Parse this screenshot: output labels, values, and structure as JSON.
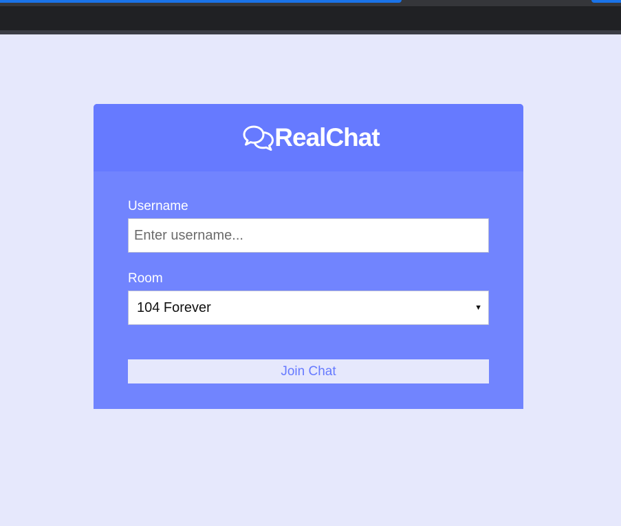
{
  "app": {
    "brand_name": "RealChat",
    "brand_icon": "comments-icon",
    "colors": {
      "page_bg": "#e6e8fc",
      "card_bg": "#7184fe",
      "header_bg": "#667aff",
      "button_bg": "#e6e8fc",
      "button_text": "#667aff"
    }
  },
  "form": {
    "username": {
      "label": "Username",
      "placeholder": "Enter username...",
      "value": ""
    },
    "room": {
      "label": "Room",
      "selected": "104 Forever"
    },
    "join_button_label": "Join Chat"
  }
}
